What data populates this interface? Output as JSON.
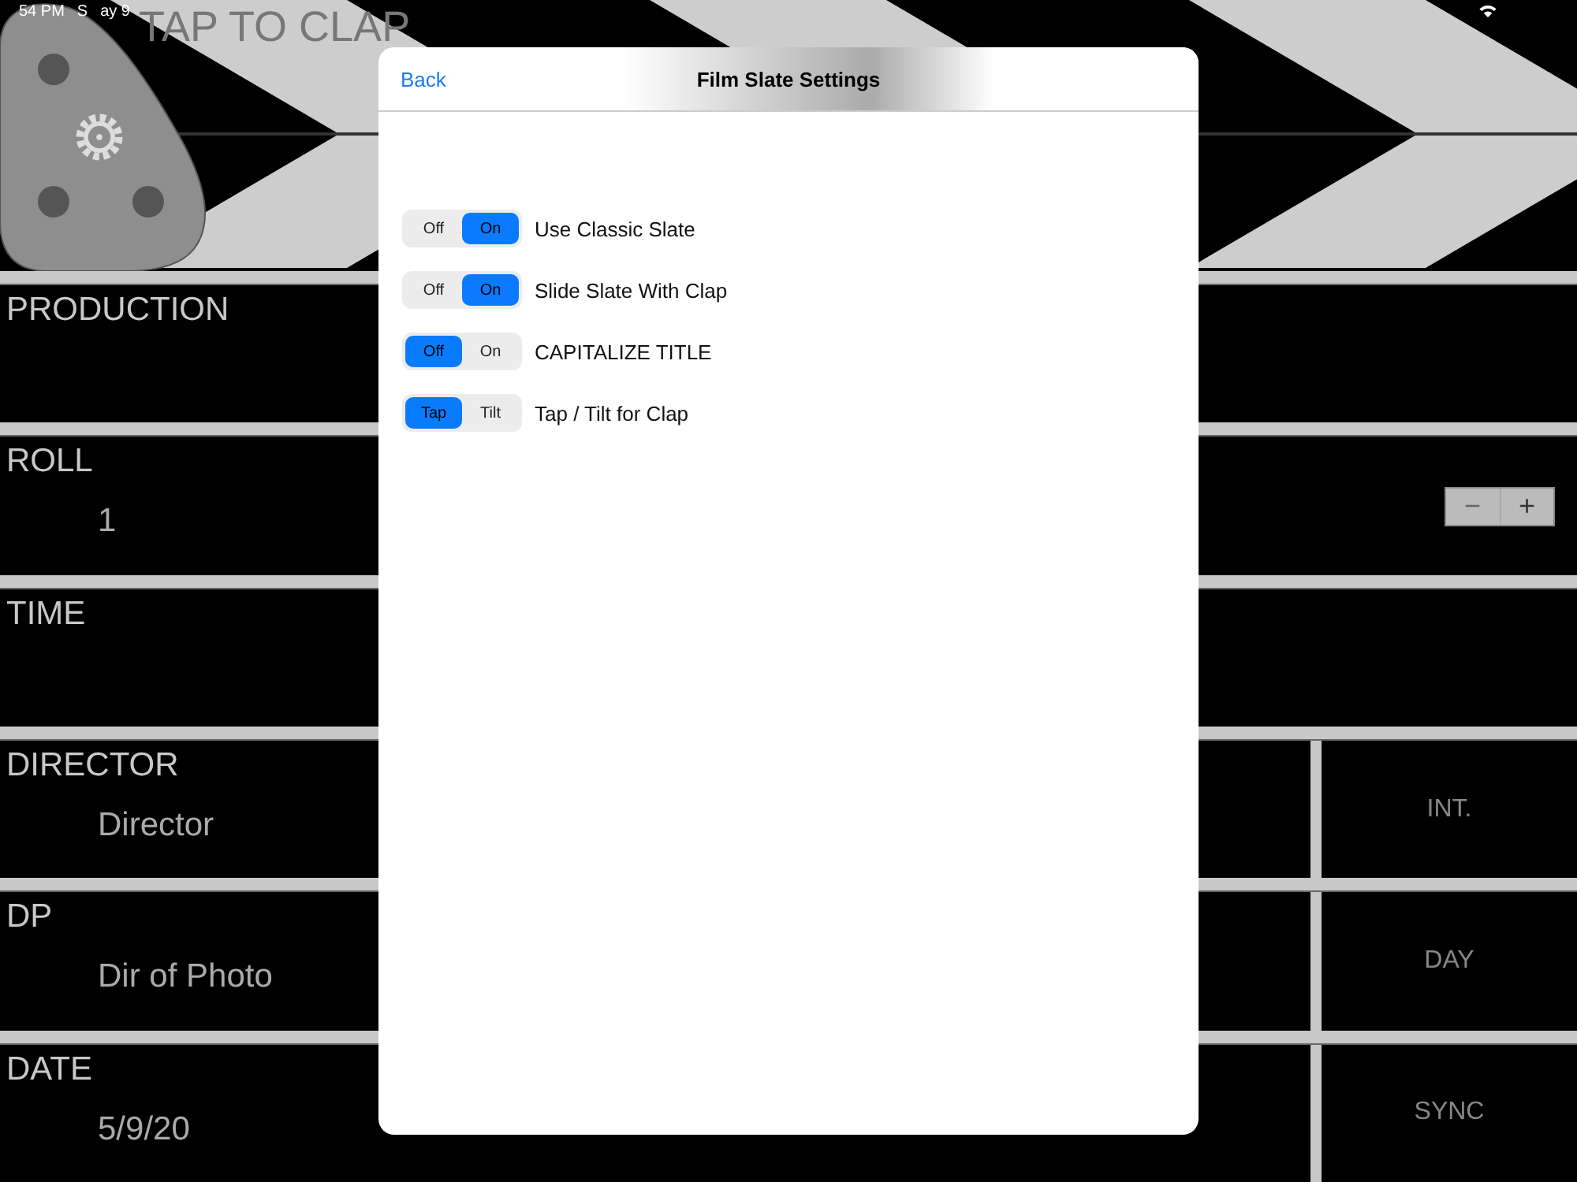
{
  "board": {
    "title": "TAP TO CLAP",
    "status": {
      "time": "54 PM",
      "date_parts": [
        "S",
        "ay 9"
      ]
    },
    "fields": [
      {
        "label": "PRODUCTION"
      },
      {
        "label": "ROLL",
        "value": "1",
        "stepper": {
          "minus": "−",
          "plus": "+"
        }
      },
      {
        "label": "TIME"
      },
      {
        "label": "DIRECTOR",
        "value": "Director",
        "side": "INT."
      },
      {
        "label": "DP",
        "value": "Dir of Photo",
        "side": "DAY"
      },
      {
        "label": "DATE",
        "value": "5/9/20",
        "side": "SYNC"
      }
    ]
  },
  "modal": {
    "back": "Back",
    "title": "Film Slate Settings",
    "settings": [
      {
        "label": "Use Classic Slate",
        "options": [
          {
            "label": "Off",
            "selected": false
          },
          {
            "label": "On",
            "selected": true
          }
        ]
      },
      {
        "label": "Slide Slate With Clap",
        "options": [
          {
            "label": "Off",
            "selected": false
          },
          {
            "label": "On",
            "selected": true
          }
        ]
      },
      {
        "label": "CAPITALIZE TITLE",
        "options": [
          {
            "label": "Off",
            "selected": true
          },
          {
            "label": "On",
            "selected": false
          }
        ]
      },
      {
        "label": "Tap / Tilt for Clap",
        "options": [
          {
            "label": "Tap",
            "selected": true
          },
          {
            "label": "Tilt",
            "selected": false
          }
        ]
      }
    ]
  }
}
